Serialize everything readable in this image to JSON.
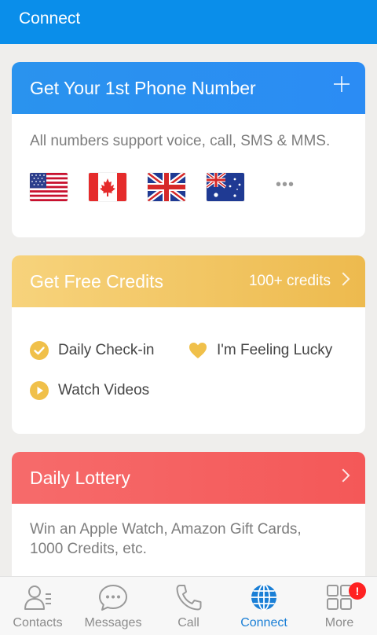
{
  "appbar": {
    "title": "Connect"
  },
  "phone_card": {
    "title": "Get Your 1st Phone Number",
    "add_icon": "plus-icon",
    "description": "All numbers support voice, call, SMS & MMS.",
    "flags": [
      "us-flag",
      "canada-flag",
      "uk-flag",
      "australia-flag"
    ],
    "more": "•••"
  },
  "credits_card": {
    "title": "Get Free Credits",
    "credits_text": "100+ credits",
    "actions": [
      {
        "label": "Daily Check-in",
        "icon": "check-circle-icon"
      },
      {
        "label": "I'm Feeling Lucky",
        "icon": "heart-icon"
      },
      {
        "label": "Watch Videos",
        "icon": "play-circle-icon"
      }
    ]
  },
  "lottery_card": {
    "title": "Daily Lottery",
    "description_line1": "Win an Apple Watch, Amazon Gift Cards,",
    "description_line2": "1000 Credits, etc."
  },
  "bottom_nav": {
    "items": [
      {
        "label": "Contacts",
        "icon": "contacts-icon"
      },
      {
        "label": "Messages",
        "icon": "messages-icon"
      },
      {
        "label": "Call",
        "icon": "phone-icon"
      },
      {
        "label": "Connect",
        "icon": "globe-icon",
        "active": true
      },
      {
        "label": "More",
        "icon": "grid-icon",
        "badge": "!"
      }
    ]
  },
  "colors": {
    "appbar": "#0a8eea",
    "phone_header": "#2b8ff1",
    "credits_header": "#f2c564",
    "lottery_header": "#f56262",
    "active_nav": "#1a7fd6",
    "accent_yellow": "#f0c04a"
  }
}
